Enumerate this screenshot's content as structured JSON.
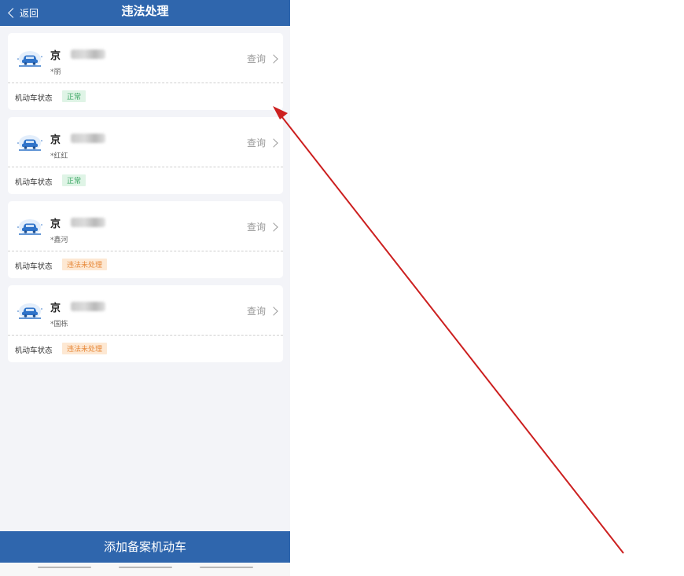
{
  "nav": {
    "back_label": "返回",
    "title": "违法处理"
  },
  "vehicles": [
    {
      "plate_prefix": "京",
      "owner": "*丽",
      "query_label": "查询",
      "status_label": "机动车状态",
      "status": "正常",
      "status_type": "ok"
    },
    {
      "plate_prefix": "京",
      "owner": "*红红",
      "query_label": "查询",
      "status_label": "机动车状态",
      "status": "正常",
      "status_type": "ok"
    },
    {
      "plate_prefix": "京",
      "owner": "*鑫河",
      "query_label": "查询",
      "status_label": "机动车状态",
      "status": "违法未处理",
      "status_type": "warn"
    },
    {
      "plate_prefix": "京",
      "owner": "*国栋",
      "query_label": "查询",
      "status_label": "机动车状态",
      "status": "违法未处理",
      "status_type": "warn"
    }
  ],
  "bottom_button": {
    "label": "添加备案机动车"
  },
  "colors": {
    "nav": "#2f66ad",
    "ok_tag_bg": "#dff4e6",
    "ok_tag_text": "#38a560",
    "warn_tag_bg": "#fde8d3",
    "warn_tag_text": "#e7893a",
    "annotation_arrow": "#cc1f1f"
  }
}
